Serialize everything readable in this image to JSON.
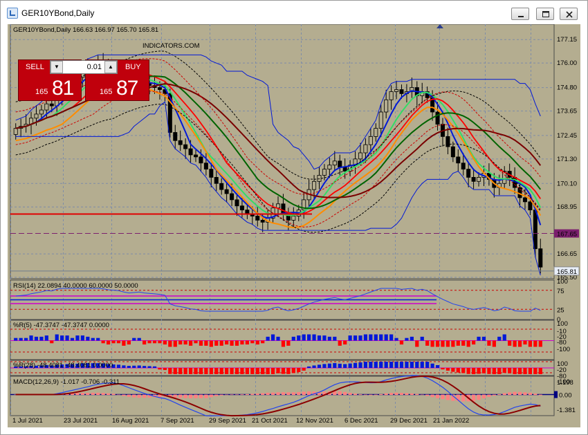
{
  "window": {
    "title": "GER10YBond,Daily"
  },
  "chart_header": {
    "text": "GER10YBond,Daily  166.63 166.97 165.70 165.81"
  },
  "watermark": "INDICATORS.COM",
  "trade_panel": {
    "sell_label": "SELL",
    "buy_label": "BUY",
    "lot": "0.01",
    "sell_small": "165",
    "sell_big": "81",
    "buy_small": "165",
    "buy_big": "87",
    "down_arrow": "▼",
    "up_arrow": "▲"
  },
  "price_axis": [
    "177.15",
    "176.00",
    "174.80",
    "173.65",
    "172.45",
    "171.30",
    "170.10",
    "168.95",
    "166.65",
    "165.50"
  ],
  "price_tags": {
    "hline": "167.65",
    "current": "165.81"
  },
  "rsi": {
    "label": "RSI(14) 22.0894 40.0000 60.0000 50.0000",
    "levels": [
      "100",
      "75",
      "25",
      "0"
    ]
  },
  "wpr5": {
    "label": "%R(5) -47.3747 -47.3747 0.0000",
    "levels": [
      "100",
      "-10",
      "-20",
      "-80",
      "-100"
    ]
  },
  "wpr28": {
    "label": "%R(28) -48.4081 -48.4081 0.0000",
    "levels": [
      "100",
      "-20",
      "-80",
      "-100"
    ]
  },
  "macd": {
    "label": "MACD(12,26,9) -1.017 -0.706 -0.311",
    "levels": [
      "1.198",
      "0.00",
      "-1.381"
    ]
  },
  "x_axis": [
    "1 Jul 2021",
    "23 Jul 2021",
    "16 Aug 2021",
    "7 Sep 2021",
    "29 Sep 2021",
    "21 Oct 2021",
    "12 Nov 2021",
    "6 Dec 2021",
    "29 Dec 2021",
    "21 Jan 2022"
  ],
  "colors": {
    "background": "#b4ad90",
    "bull_candle": "#000000",
    "grid": "#7d8ca8",
    "hline": "#7b1e6e",
    "sell": "#c0000c"
  },
  "chart_data": {
    "type": "candlestick",
    "symbol": "GER10YBond",
    "timeframe": "Daily",
    "ohlc_last": {
      "open": 166.63,
      "high": 166.97,
      "low": 165.7,
      "close": 165.81
    },
    "ylim": [
      165.5,
      177.7
    ],
    "x_tick_labels": [
      "1 Jul 2021",
      "23 Jul 2021",
      "16 Aug 2021",
      "7 Sep 2021",
      "29 Sep 2021",
      "21 Oct 2021",
      "12 Nov 2021",
      "6 Dec 2021",
      "29 Dec 2021",
      "21 Jan 2022"
    ],
    "closes": [
      172.8,
      172.9,
      173.0,
      173.3,
      173.5,
      173.7,
      174.0,
      173.9,
      174.3,
      174.6,
      174.9,
      175.0,
      175.3,
      175.6,
      175.8,
      175.9,
      176.0,
      175.9,
      175.7,
      175.6,
      175.5,
      175.2,
      175.0,
      175.1,
      175.2,
      175.0,
      174.9,
      174.8,
      174.7,
      174.5,
      172.6,
      172.2,
      172.0,
      171.8,
      171.5,
      171.4,
      171.1,
      170.8,
      170.4,
      170.1,
      169.8,
      169.6,
      169.3,
      169.0,
      168.8,
      168.6,
      168.5,
      168.3,
      168.2,
      168.4,
      168.9,
      169.1,
      168.6,
      168.3,
      168.5,
      168.8,
      169.3,
      169.8,
      170.2,
      170.5,
      170.8,
      171.0,
      171.2,
      170.9,
      170.7,
      171.0,
      171.3,
      171.6,
      172.0,
      172.4,
      172.8,
      173.6,
      174.2,
      174.6,
      174.7,
      174.5,
      174.6,
      174.8,
      174.4,
      174.6,
      174.3,
      173.6,
      173.0,
      172.4,
      171.9,
      171.4,
      171.1,
      170.8,
      170.4,
      170.2,
      170.4,
      170.6,
      170.3,
      169.9,
      170.1,
      170.7,
      170.4,
      169.9,
      169.4,
      169.2,
      168.8,
      166.9,
      166.0
    ],
    "indicator_series": [
      "SMA blue",
      "EMA green",
      "EMA orange",
      "SMA red",
      "SMA dark red",
      "SMA black",
      "Price channel",
      "Envelope bands"
    ],
    "horizontal_line": 167.65,
    "rsi": {
      "current": 22.0894,
      "levels": [
        40,
        60,
        50
      ]
    },
    "wpr5": {
      "current": -47.3747
    },
    "wpr28": {
      "current": -48.4081
    },
    "macd": {
      "main": -1.017,
      "signal": -0.706,
      "hist": -0.311,
      "ylim": [
        -1.381,
        1.198
      ]
    }
  }
}
